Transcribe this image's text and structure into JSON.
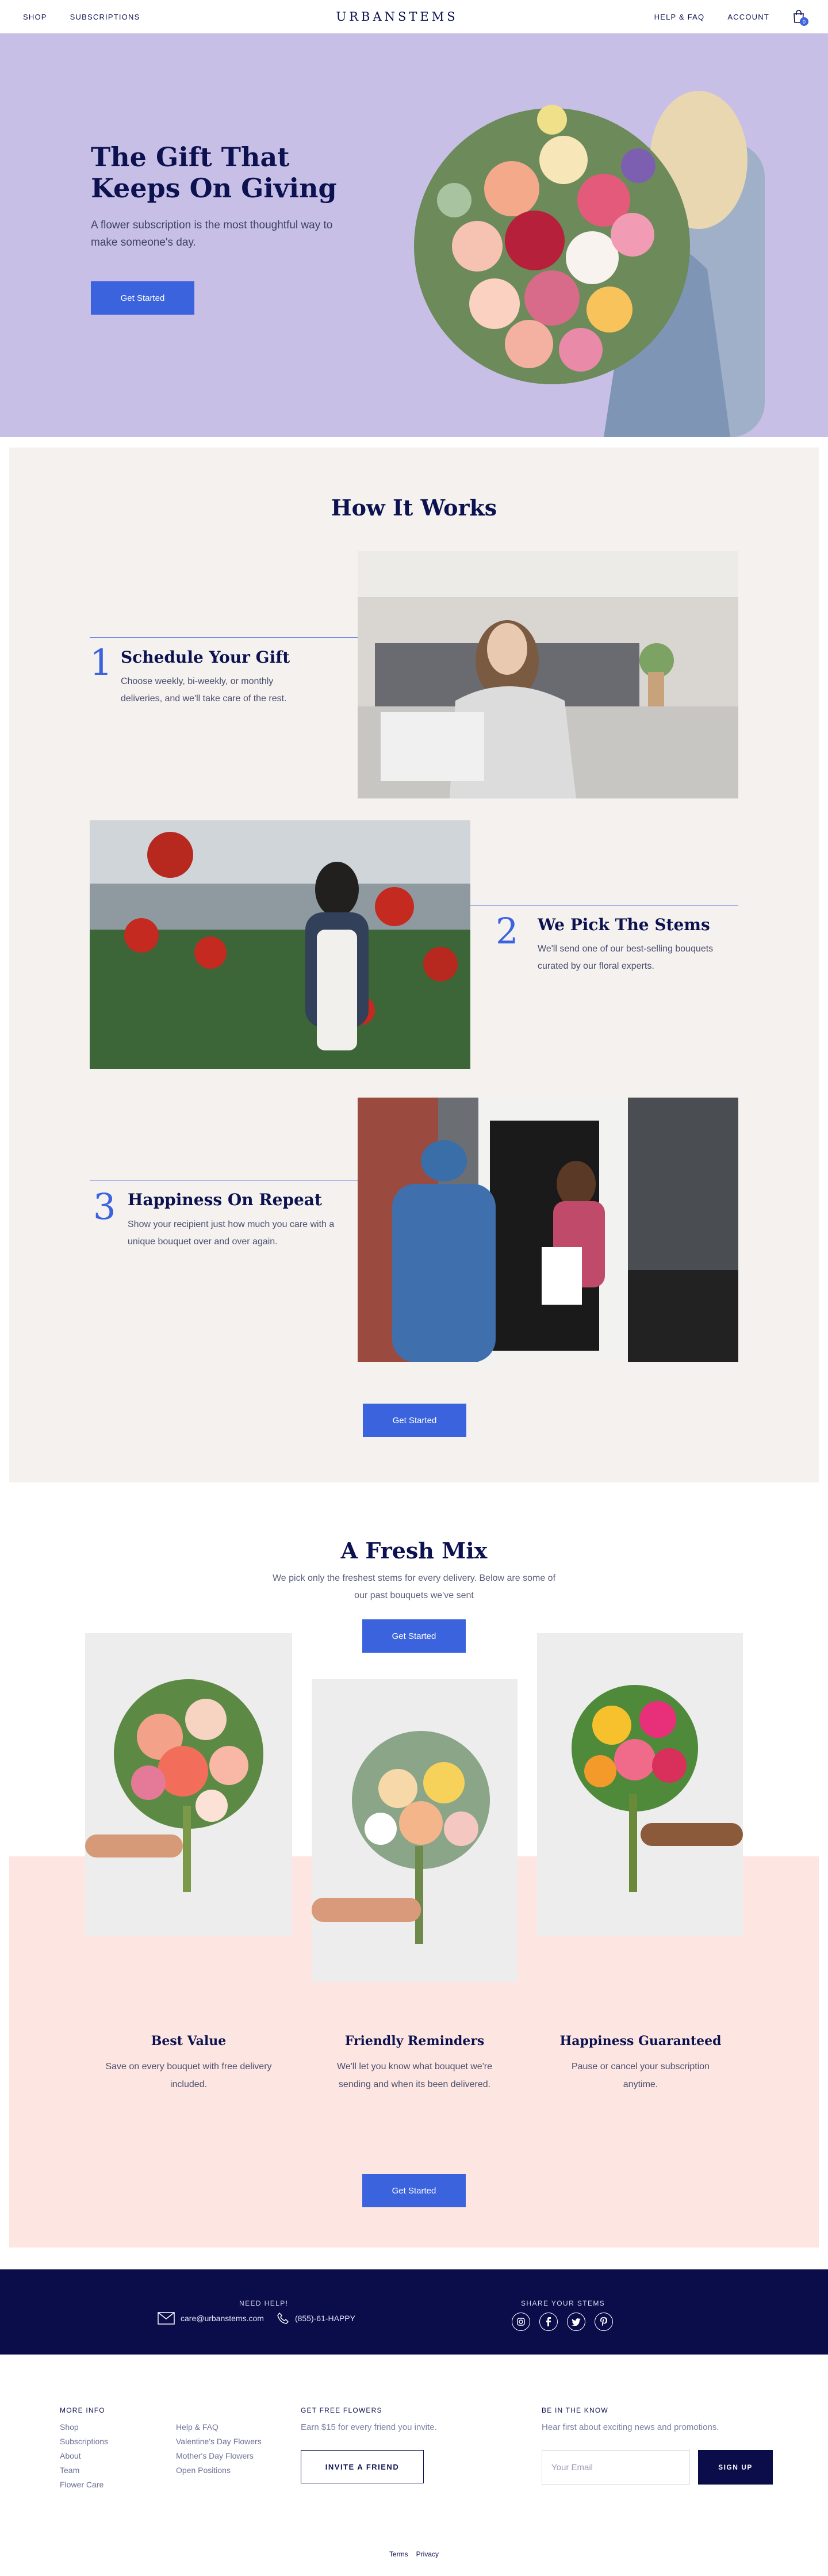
{
  "header": {
    "nav_left": [
      "SHOP",
      "SUBSCRIPTIONS"
    ],
    "logo": "URBANSTEMS",
    "nav_right": [
      "HELP & FAQ",
      "ACCOUNT"
    ],
    "cart_count": "0"
  },
  "hero": {
    "title": "The Gift That Keeps On Giving",
    "subtitle": "A flower subscription is the most thoughtful way to make someone's day.",
    "cta": "Get Started"
  },
  "how": {
    "title": "How It Works",
    "steps": [
      {
        "num": "1",
        "title": "Schedule Your Gift",
        "text": "Choose weekly, bi-weekly, or monthly deliveries, and we'll take care of the rest."
      },
      {
        "num": "2",
        "title": "We Pick The Stems",
        "text": "We'll send one of our best-selling bouquets curated by our floral experts."
      },
      {
        "num": "3",
        "title": "Happiness On Repeat",
        "text": "Show your recipient just how much you care with a unique bouquet over and over again."
      }
    ],
    "cta": "Get Started"
  },
  "mix": {
    "title": "A Fresh Mix",
    "subtitle": "We pick only the freshest stems for every delivery. Below are some of our past bouquets we've sent",
    "cta_top": "Get Started",
    "cards": [
      {
        "title": "Best Value",
        "text": "Save on every bouquet with free delivery included."
      },
      {
        "title": "Friendly Reminders",
        "text": "We'll let you know what bouquet we're sending and when its been delivered."
      },
      {
        "title": "Happiness Guaranteed",
        "text": "Pause or cancel your subscription anytime."
      }
    ],
    "cta_bottom": "Get Started"
  },
  "help": {
    "need_help": "NEED HELP!",
    "email": "care@urbanstems.com",
    "phone": "(855)-61-HAPPY",
    "share": "SHARE YOUR STEMS"
  },
  "footer": {
    "more_info": "MORE INFO",
    "links_col1": [
      "Shop",
      "Subscriptions",
      "About",
      "Team",
      "Flower Care"
    ],
    "links_col2": [
      "Help & FAQ",
      "Valentine's Day Flowers",
      "Mother's Day Flowers",
      "Open Positions"
    ],
    "free_flowers_title": "GET FREE FLOWERS",
    "free_flowers_text": "Earn $15 for every friend you invite.",
    "invite_button": "INVITE A FRIEND",
    "know_title": "BE IN THE KNOW",
    "know_text": "Hear first about exciting news and promotions.",
    "email_placeholder": "Your Email",
    "signup_button": "SIGN UP",
    "legal": [
      "Terms",
      "Privacy"
    ]
  },
  "colors": {
    "accent": "#3b63dd",
    "navy": "#0b0c4a",
    "hero_bg": "#c7bfe6",
    "how_bg": "#f4f1ee",
    "pink_bg": "#fde6e1"
  }
}
